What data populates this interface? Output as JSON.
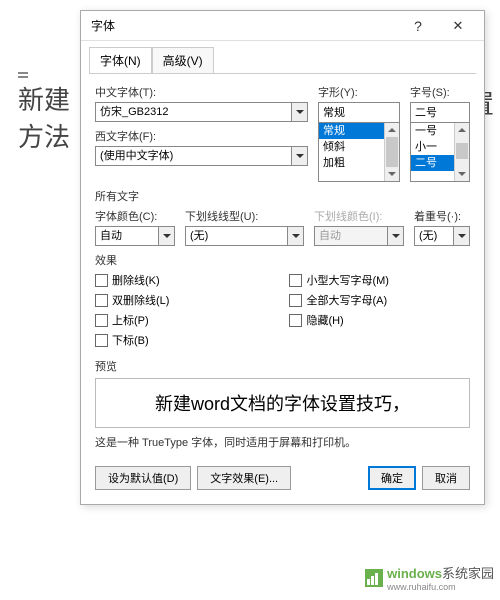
{
  "background": {
    "line1": "新建",
    "line2": "方法",
    "rightFragment": "殳置"
  },
  "dialog": {
    "title": "字体",
    "tabs": {
      "font": "字体(N)",
      "advanced": "高级(V)"
    },
    "labels": {
      "cnFont": "中文字体(T):",
      "westFont": "西文字体(F):",
      "style": "字形(Y):",
      "size": "字号(S):",
      "allText": "所有文字",
      "fontColor": "字体颜色(C):",
      "underline": "下划线线型(U):",
      "underlineColor": "下划线颜色(I):",
      "emphasis": "着重号(·):",
      "effects": "效果",
      "preview": "预览"
    },
    "values": {
      "cnFont": "仿宋_GB2312",
      "westFont": "(使用中文字体)",
      "style": "常规",
      "size": "二号",
      "fontColor": "自动",
      "underline": "(无)",
      "underlineColor": "自动",
      "emphasis": "(无)"
    },
    "styleList": [
      "常规",
      "倾斜",
      "加粗"
    ],
    "sizeList": [
      "一号",
      "小一",
      "二号"
    ],
    "effects": {
      "strike": "删除线(K)",
      "dblStrike": "双删除线(L)",
      "superscript": "上标(P)",
      "subscript": "下标(B)",
      "smallCaps": "小型大写字母(M)",
      "allCaps": "全部大写字母(A)",
      "hidden": "隐藏(H)"
    },
    "previewText": "新建word文档的字体设置技巧，",
    "previewDesc": "这是一种 TrueType 字体，同时适用于屏幕和打印机。",
    "buttons": {
      "setDefault": "设为默认值(D)",
      "textEffects": "文字效果(E)...",
      "ok": "确定",
      "cancel": "取消"
    }
  },
  "watermark": {
    "brand": "windows",
    "suffix": "系统家园",
    "url": "www.ruhaifu.com"
  }
}
